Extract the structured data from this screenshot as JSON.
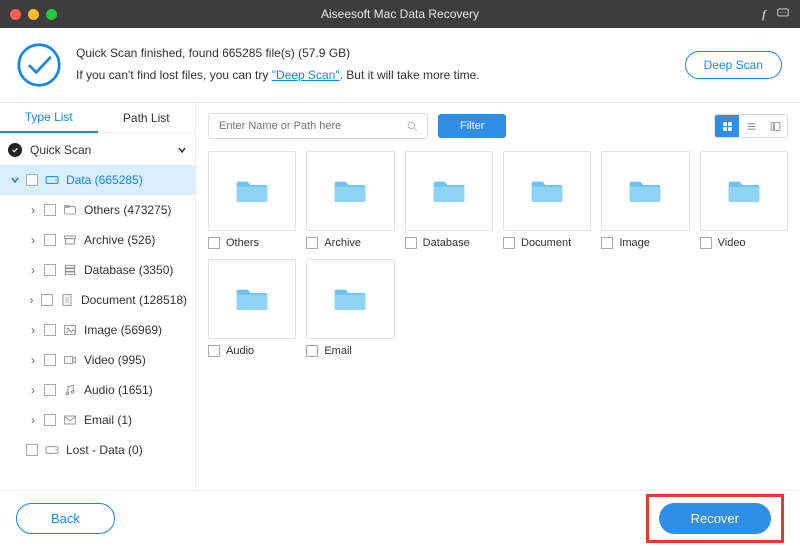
{
  "titlebar": {
    "title": "Aiseesoft Mac Data Recovery"
  },
  "summary": {
    "line1": "Quick Scan finished, found 665285 file(s) (57.9 GB)",
    "line2_prefix": "If you can't find lost files, you can try ",
    "deep_scan_link": "\"Deep Scan\"",
    "line2_suffix": ". But it will take more time.",
    "deep_scan_btn": "Deep Scan"
  },
  "tabs": {
    "type_list": "Type List",
    "path_list": "Path List"
  },
  "tree": {
    "root_label": "Quick Scan",
    "data": {
      "label": "Data (665285)"
    },
    "children": [
      {
        "label": "Others (473275)"
      },
      {
        "label": "Archive (526)"
      },
      {
        "label": "Database (3350)"
      },
      {
        "label": "Document (128518)"
      },
      {
        "label": "Image (56969)"
      },
      {
        "label": "Video (995)"
      },
      {
        "label": "Audio (1651)"
      },
      {
        "label": "Email (1)"
      }
    ],
    "lost_data": {
      "label": "Lost - Data (0)"
    }
  },
  "search": {
    "placeholder": "Enter Name or Path here"
  },
  "filter_btn": "Filter",
  "tiles": [
    {
      "label": "Others"
    },
    {
      "label": "Archive"
    },
    {
      "label": "Database"
    },
    {
      "label": "Document"
    },
    {
      "label": "Image"
    },
    {
      "label": "Video"
    },
    {
      "label": "Audio"
    },
    {
      "label": "Email"
    }
  ],
  "footer": {
    "back": "Back",
    "recover": "Recover"
  }
}
